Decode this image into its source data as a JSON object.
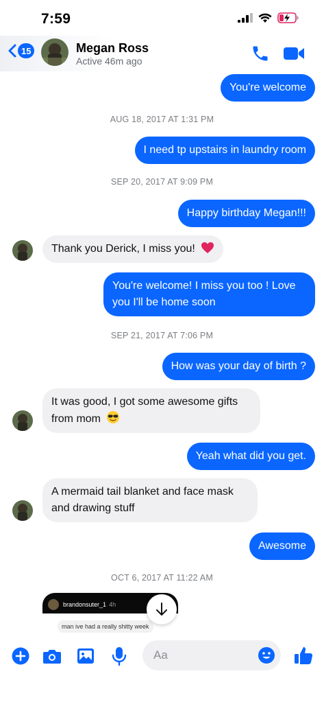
{
  "status_bar": {
    "time": "7:59"
  },
  "header": {
    "back_count": "15",
    "name": "Megan Ross",
    "status": "Active 46m ago"
  },
  "messages": {
    "m1": "You're welcome",
    "ts1": "AUG 18, 2017 AT 1:31 PM",
    "m2": "I need tp upstairs in laundry room",
    "ts2": "SEP 20, 2017 AT 9:09 PM",
    "m3": "Happy birthday Megan!!!",
    "m4": "Thank you Derick, I miss you!",
    "m5_line1": "You're welcome! I miss you too ! Love",
    "m5_line2": "you I'll be home soon",
    "ts3": "SEP 21, 2017 AT 7:06 PM",
    "m6": "How was your day of birth ?",
    "m7_line1": "It was good, I got some awesome gifts",
    "m7_line2": "from mom",
    "m8": "Yeah what did you get.",
    "m9_line1": "A mermaid tail blanket and face mask",
    "m9_line2": "and drawing stuff",
    "m10": "Awesome",
    "ts4": "OCT 6, 2017 AT 11:22 AM"
  },
  "shared_story": {
    "username": "brandonsuter_1",
    "age": "4h",
    "caption": "man ive had a really shitty week"
  },
  "composer": {
    "placeholder": "Aa"
  },
  "colors": {
    "accent": "#0a66ff",
    "incoming_bubble": "#f0f0f2",
    "heart": "#e0245e"
  },
  "icons": [
    "back-chevron-icon",
    "phone-icon",
    "video-camera-icon",
    "plus-icon",
    "camera-icon",
    "photo-icon",
    "microphone-icon",
    "emoji-icon",
    "thumbs-up-icon",
    "arrow-down-icon"
  ]
}
